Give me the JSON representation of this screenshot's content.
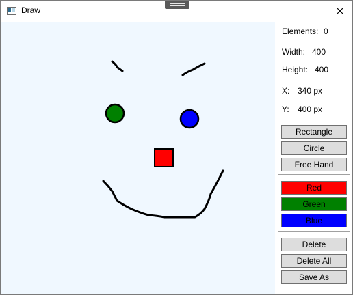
{
  "window": {
    "title": "Draw",
    "icon": "app-window-icon"
  },
  "panel": {
    "elements_label": "Elements:",
    "elements_value": "0",
    "width_label": "Width:",
    "width_value": "400",
    "height_label": "Height:",
    "height_value": "400",
    "x_label": "X:",
    "x_value": "340 px",
    "y_label": "Y:",
    "y_value": "400 px"
  },
  "buttons": {
    "rectangle": "Rectangle",
    "circle": "Circle",
    "free_hand": "Free Hand",
    "delete": "Delete",
    "delete_all": "Delete All",
    "save_as": "Save As"
  },
  "colors": [
    {
      "label": "Red",
      "hex": "#ff0000"
    },
    {
      "label": "Green",
      "hex": "#008000"
    },
    {
      "label": "Blue",
      "hex": "#0000ff"
    }
  ],
  "canvas": {
    "background": "#f0f8ff",
    "stroke": "#000000",
    "shapes": [
      "left-eyebrow",
      "right-eyebrow",
      "green-circle",
      "blue-circle",
      "red-square",
      "smile"
    ]
  }
}
